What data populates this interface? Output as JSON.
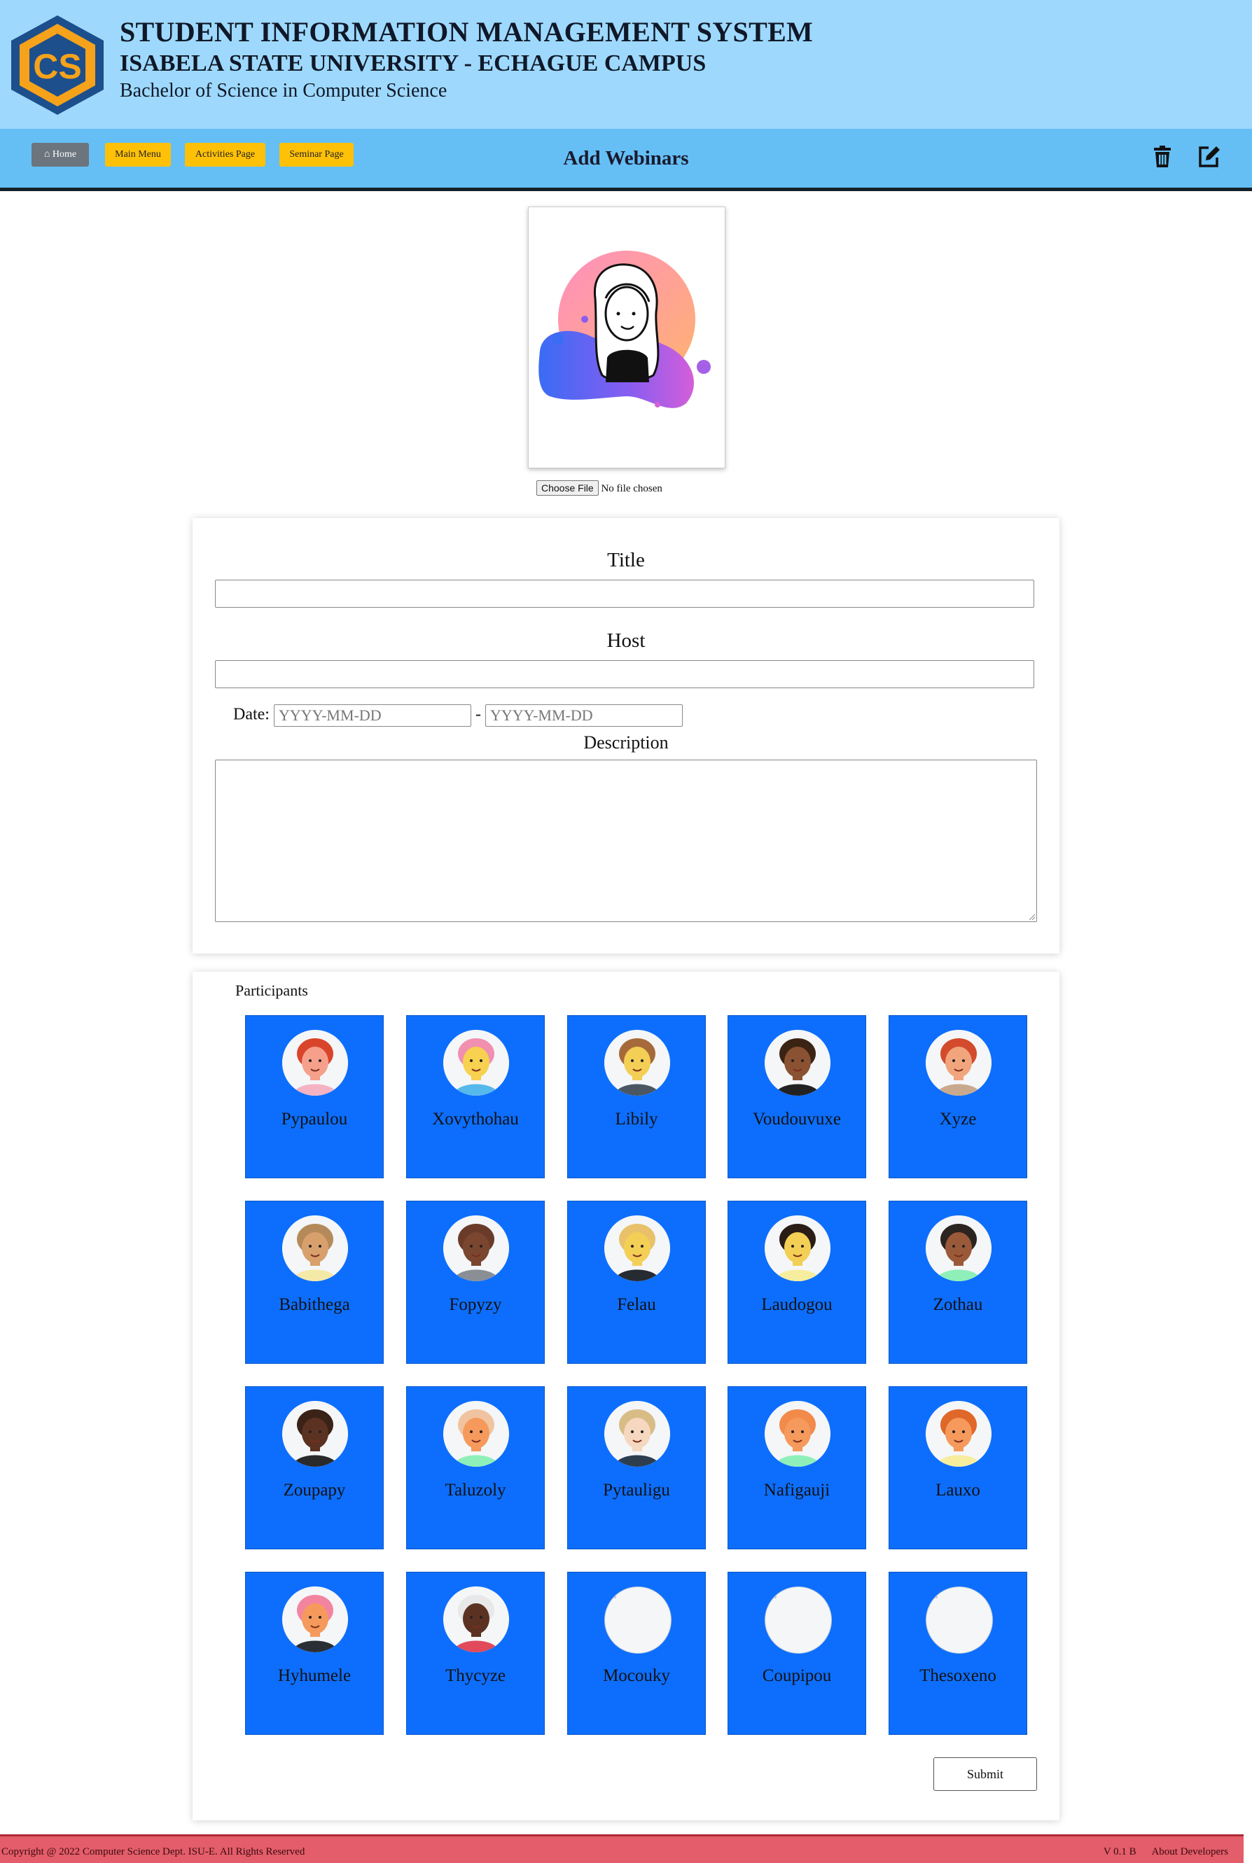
{
  "header": {
    "system_title": "STUDENT INFORMATION MANAGEMENT SYSTEM",
    "university": "ISABELA STATE UNIVERSITY - ECHAGUE CAMPUS",
    "program": "Bachelor of Science in Computer Science",
    "logo_icon": "cs-hexagon-logo"
  },
  "nav": {
    "home_label": "Home",
    "main_menu_label": "Main Menu",
    "activities_label": "Activities Page",
    "seminar_label": "Seminar Page",
    "page_title": "Add Webinars",
    "delete_icon": "trash-icon",
    "edit_icon": "edit-icon"
  },
  "upload": {
    "button_label": "Choose File",
    "status": "No file chosen"
  },
  "form": {
    "title_label": "Title",
    "title_value": "",
    "host_label": "Host",
    "host_value": "",
    "date_label": "Date:",
    "date_start_placeholder": "YYYY-MM-DD",
    "date_separator": "-",
    "date_end_placeholder": "YYYY-MM-DD",
    "description_label": "Description",
    "description_value": ""
  },
  "participants": {
    "label": "Participants",
    "items": [
      {
        "name": "Pypaulou",
        "hair": "#d9452b",
        "skin": "#f6a08c",
        "shirt": "#f4b3c2",
        "has_image": true
      },
      {
        "name": "Xovythohau",
        "hair": "#f08fb0",
        "skin": "#f7d14f",
        "shirt": "#57b8ec",
        "has_image": true
      },
      {
        "name": "Libily",
        "hair": "#a66a3a",
        "skin": "#f3cf55",
        "shirt": "#4a5662",
        "has_image": true
      },
      {
        "name": "Voudouvuxe",
        "hair": "#3b2314",
        "skin": "#8a5232",
        "shirt": "#222222",
        "has_image": true
      },
      {
        "name": "Xyze",
        "hair": "#d44a2c",
        "skin": "#f0a57c",
        "shirt": "#c9a98d",
        "has_image": true
      },
      {
        "name": "Babithega",
        "hair": "#b58a5a",
        "skin": "#d8a06c",
        "shirt": "#f5e9a8",
        "has_image": true
      },
      {
        "name": "Fopyzy",
        "hair": "#6b3b2a",
        "skin": "#7a4630",
        "shirt": "#8a8f96",
        "has_image": true
      },
      {
        "name": "Felau",
        "hair": "#e8c16a",
        "skin": "#f3cf55",
        "shirt": "#262b31",
        "has_image": true
      },
      {
        "name": "Laudogou",
        "hair": "#2a1d16",
        "skin": "#f3cf55",
        "shirt": "#f6ee9e",
        "has_image": true
      },
      {
        "name": "Zothau",
        "hair": "#2c2420",
        "skin": "#9a5a3a",
        "shirt": "#8ef0b8",
        "has_image": true
      },
      {
        "name": "Zoupapy",
        "hair": "#3a2216",
        "skin": "#5b3222",
        "shirt": "#2a2a2a",
        "has_image": true
      },
      {
        "name": "Taluzoly",
        "hair": "#f0c4a0",
        "skin": "#f59a5c",
        "shirt": "#8ef0b8",
        "has_image": true
      },
      {
        "name": "Pytauligu",
        "hair": "#d8bc86",
        "skin": "#f6d7c0",
        "shirt": "#2d3e50",
        "has_image": true
      },
      {
        "name": "Nafigauji",
        "hair": "#f28a4a",
        "skin": "#f59a5c",
        "shirt": "#8ef0b8",
        "has_image": true
      },
      {
        "name": "Lauxo",
        "hair": "#e0672a",
        "skin": "#f59a5c",
        "shirt": "#f6ee9e",
        "has_image": true
      },
      {
        "name": "Hyhumele",
        "hair": "#f284a0",
        "skin": "#f59a5c",
        "shirt": "#2a2f35",
        "has_image": true
      },
      {
        "name": "Thycyze",
        "hair": "#e8e8e8",
        "skin": "#5b3222",
        "shirt": "#e04a5a",
        "has_image": true
      },
      {
        "name": "Mocouky",
        "has_image": false
      },
      {
        "name": "Coupipou",
        "has_image": false
      },
      {
        "name": "Thesoxeno",
        "has_image": false
      }
    ],
    "submit_label": "Submit"
  },
  "footer": {
    "copyright": "Copyright @ 2022 Computer Science Dept. ISU-E. All Rights Reserved",
    "version": "V 0.1 B",
    "about": "About Developers"
  },
  "colors": {
    "banner": "#9ed9fd",
    "navbar": "#65bff5",
    "tile": "#0d6efd",
    "footer": "#e35d6a"
  }
}
